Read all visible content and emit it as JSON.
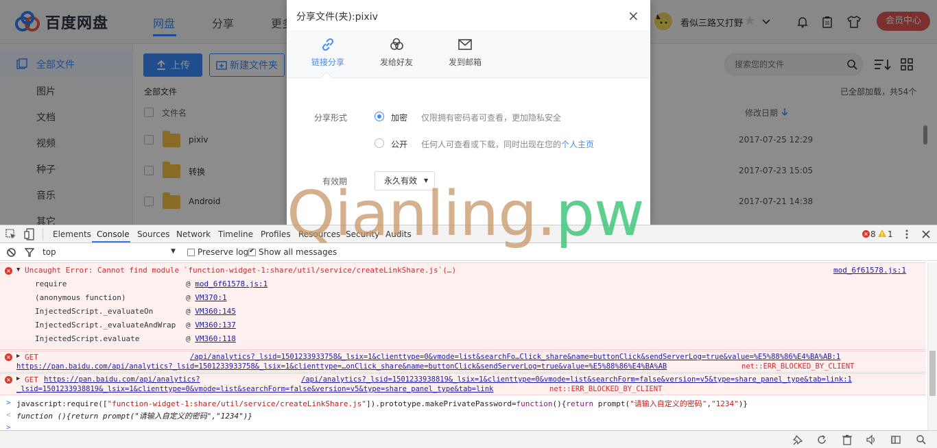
{
  "app": {
    "logo_text": "百度网盘",
    "nav_tabs": [
      "网盘",
      "分享",
      "更多"
    ],
    "user_name": "看似三路又打野",
    "vip_button": "会员中心"
  },
  "sidebar": {
    "items": [
      "全部文件",
      "图片",
      "文档",
      "视频",
      "种子",
      "音乐",
      "其它"
    ]
  },
  "toolbar": {
    "upload_label": "上传",
    "new_folder_label": "新建文件夹",
    "search_placeholder": "搜索您的文件"
  },
  "file_list": {
    "breadcrumb": "全部文件",
    "loaded_status": "已全部加载，共54个",
    "col_name": "文件名",
    "col_date": "修改日期",
    "rows": [
      {
        "name": "pixiv",
        "date": "2017-07-25 12:29"
      },
      {
        "name": "转换",
        "date": "2017-07-23 15:05"
      },
      {
        "name": "Android",
        "date": "2017-07-21 14:38"
      }
    ]
  },
  "dialog": {
    "title": "分享文件(夹):pixiv",
    "close_symbol": "×",
    "tabs": [
      "链接分享",
      "发给好友",
      "发到邮箱"
    ],
    "share_form_label": "分享形式",
    "option_private": "加密",
    "option_private_desc": "仅限拥有密码者可查看，更加隐私安全",
    "option_public": "公开",
    "option_public_desc": "任何人可查看或下载，同时出现在您的",
    "option_public_link": "个人主页",
    "expiry_label": "有效期",
    "expiry_value": "永久有效"
  },
  "watermark": {
    "part1": "Qianling.",
    "part2": "pw"
  },
  "devtools": {
    "tabs": [
      "Elements",
      "Console",
      "Sources",
      "Network",
      "Timeline",
      "Profiles",
      "Resources",
      "Security",
      "Audits"
    ],
    "error_count": "8",
    "warning_count": "1",
    "context": "top",
    "preserve_log": "Preserve log",
    "show_all_messages": "Show all messages",
    "error1": {
      "message": "Uncaught Error: Cannot find module `function-widget-1:share/util/service/createLinkShare.js`(…)",
      "source": "mod_6f61578.js:1",
      "trace": [
        {
          "fn": "require",
          "loc": "mod_6f61578.js:1"
        },
        {
          "fn": "(anonymous function)",
          "loc": "VM370:1"
        },
        {
          "fn": "InjectedScript._evaluateOn",
          "loc": "VM360:145"
        },
        {
          "fn": "InjectedScript._evaluateAndWrap",
          "loc": "VM360:137"
        },
        {
          "fn": "InjectedScript.evaluate",
          "loc": "VM360:118"
        }
      ]
    },
    "error2": {
      "method": "GET",
      "url_line1": "/api/analytics?_lsid=1501233933758&_lsix=1&clienttype=0&vmode=list&searchFo…Click_share&name=buttonClick&sendServerLog=true&value=%E5%88%86%E4%BA%AB:1",
      "url_line2": "https://pan.baidu.com/api/analytics?_lsid=1501233933758&_lsix=1&clienttype=…onClick_share&name=buttonClick&sendServerLog=true&value=%E5%88%86%E4%BA%AB",
      "status": "net::ERR_BLOCKED_BY_CLIENT"
    },
    "error3": {
      "method": "GET",
      "host": "https://pan.baidu.com/api/analytics?",
      "url_line1": "/api/analytics?_lsid=1501233938819&_lsix=1&clienttype=0&vmode=list&searchForm=false&version=v5&type=share_panel_type&tab=link:1",
      "url_line2": "_lsid=1501233938819&_lsix=1&clienttype=0&vmode=list&searchForm=false&version=v5&type=share_panel_type&tab=link",
      "status": "net::ERR_BLOCKED_BY_CLIENT"
    },
    "input_prefix": "javascript:require([",
    "input_module": "\"function-widget-1:share/util/service/createLinkShare.js\"",
    "input_mid": "]).prototype.makePrivatePassword=",
    "input_kw_function": "function",
    "input_body_a": "(){",
    "input_kw_return": "return",
    "input_body_b": " prompt(",
    "input_str1": "\"请输入自定义的密码\"",
    "input_comma": ",",
    "input_str2": "\"1234\"",
    "input_end": ")}",
    "result": "function (){return prompt(\"请输入自定义的密码\",\"1234\")}",
    "prompt_symbol": ">",
    "result_symbol": "<",
    "cursor_symbol": ">"
  }
}
